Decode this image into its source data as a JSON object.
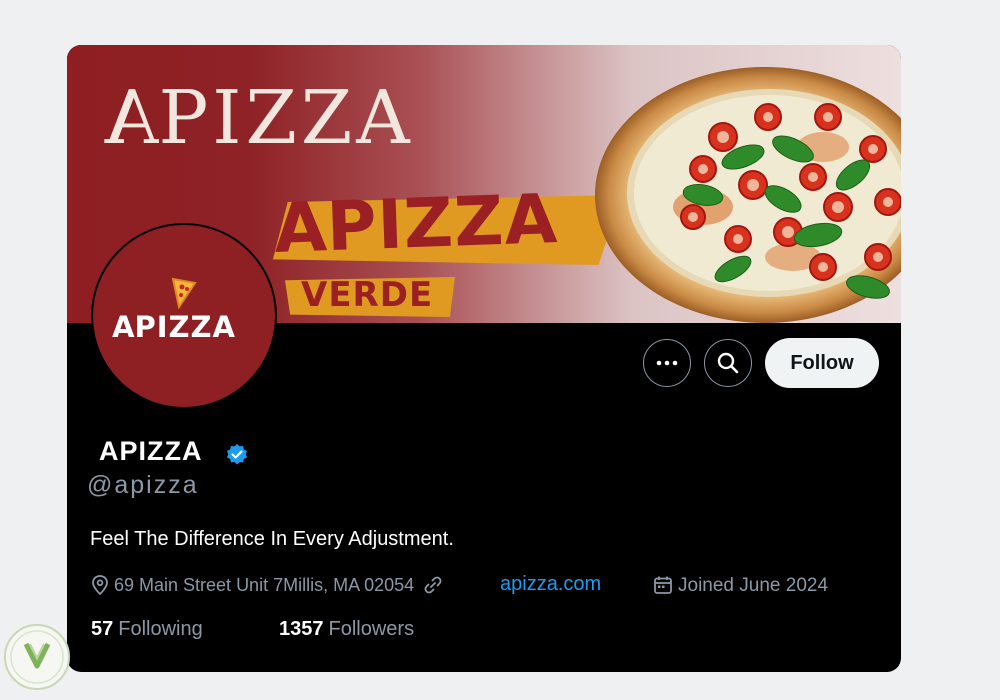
{
  "banner": {
    "logo_text": "PIZZA",
    "logo_mark": "A",
    "promo_title": "PIZZA",
    "promo_mark": "A",
    "promo_subtitle": "VERDE"
  },
  "avatar": {
    "text": "PIZZA",
    "mark": "A"
  },
  "actions": {
    "more_icon": "more-dots-icon",
    "search_icon": "search-icon",
    "follow_label": "Follow"
  },
  "profile": {
    "name": "APIZZA",
    "verified": true,
    "handle": "@apizza",
    "bio": "Feel The Difference In Every Adjustment.",
    "location": "69 Main Street Unit 7Millis, MA 02054",
    "website": "apizza.com",
    "joined": "Joined June 2024"
  },
  "stats": {
    "following_count": "57",
    "following_label": "Following",
    "followers_count": "1357",
    "followers_label": "Followers"
  },
  "colors": {
    "brand_red": "#8e2024",
    "link_blue": "#1d9bf0",
    "muted": "#8b98a5",
    "verified_blue": "#1d9bf0"
  }
}
